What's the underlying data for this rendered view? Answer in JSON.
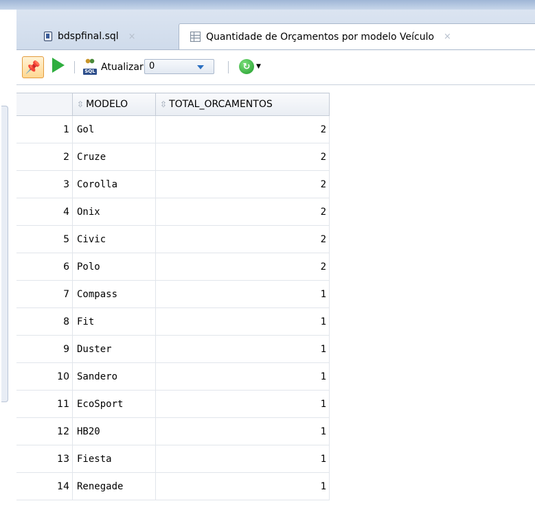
{
  "tabs": [
    {
      "label": "bdspfinal.sql",
      "icon": "database-icon",
      "active": false
    },
    {
      "label": "Quantidade de Orçamentos por modelo Veículo",
      "icon": "grid-icon",
      "active": true
    }
  ],
  "toolbar": {
    "refresh_label": "Atualizar:",
    "refresh_value": "0"
  },
  "grid": {
    "columns": [
      "MODELO",
      "TOTAL_ORCAMENTOS"
    ],
    "rows": [
      {
        "n": "1",
        "modelo": "Gol",
        "total": "2"
      },
      {
        "n": "2",
        "modelo": "Cruze",
        "total": "2"
      },
      {
        "n": "3",
        "modelo": "Corolla",
        "total": "2"
      },
      {
        "n": "4",
        "modelo": "Onix",
        "total": "2"
      },
      {
        "n": "5",
        "modelo": "Civic",
        "total": "2"
      },
      {
        "n": "6",
        "modelo": "Polo",
        "total": "2"
      },
      {
        "n": "7",
        "modelo": "Compass",
        "total": "1"
      },
      {
        "n": "8",
        "modelo": "Fit",
        "total": "1"
      },
      {
        "n": "9",
        "modelo": "Duster",
        "total": "1"
      },
      {
        "n": "10",
        "modelo": "Sandero",
        "total": "1"
      },
      {
        "n": "11",
        "modelo": "EcoSport",
        "total": "1"
      },
      {
        "n": "12",
        "modelo": "HB20",
        "total": "1"
      },
      {
        "n": "13",
        "modelo": "Fiesta",
        "total": "1"
      },
      {
        "n": "14",
        "modelo": "Renegade",
        "total": "1"
      }
    ]
  }
}
